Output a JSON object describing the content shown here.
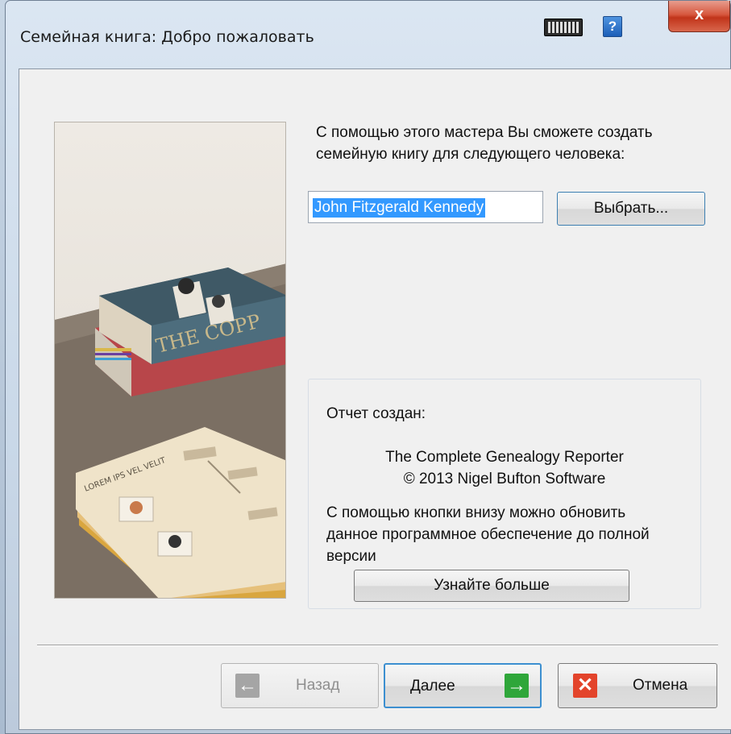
{
  "window": {
    "title": "Семейная книга: Добро пожаловать",
    "close_label": "x",
    "help_label": "?"
  },
  "main": {
    "intro_text": "С помощью этого мастера Вы сможете создать семейную книгу для следующего человека:",
    "person_value": "John Fitzgerald Kennedy",
    "choose_button": "Выбрать...",
    "illustration": {
      "book_spine_text": "THE COPP",
      "card_text": "LOREM IPS VEL VELIT"
    }
  },
  "report": {
    "created_label": "Отчет создан:",
    "product_line1": "The Complete Genealogy Reporter",
    "product_line2": "© 2013 Nigel Bufton Software",
    "upgrade_text": "С помощью кнопки внизу можно обновить данное программное обеспечение до полной версии",
    "learn_more_button": "Узнайте больше"
  },
  "footer": {
    "back_button": "Назад",
    "next_button": "Далее",
    "cancel_button": "Отмена"
  },
  "colors": {
    "selection": "#3399ff",
    "next_icon": "#2fa63a",
    "cancel_icon": "#e3442b",
    "close_button": "#c1341a"
  }
}
